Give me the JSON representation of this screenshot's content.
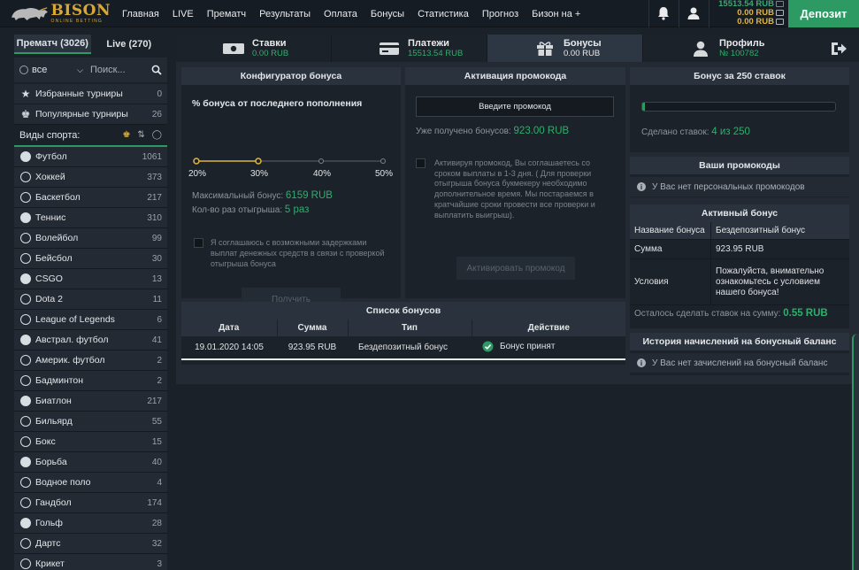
{
  "header": {
    "logo_main": "BISON",
    "logo_sub": "ONLINE BETTING",
    "nav": [
      "Главная",
      "LIVE",
      "Прематч",
      "Результаты",
      "Оплата",
      "Бонусы",
      "Статистика",
      "Прогноз",
      "Бизон на +"
    ],
    "balance_main": "15513.54 RUB",
    "balance_bonus": "0.00 RUB",
    "balance_extra": "0.00 RUB",
    "deposit_label": "Депозит",
    "icons": [
      "bell-icon",
      "user-icon"
    ]
  },
  "sidebar": {
    "tabs": [
      {
        "label": "Прематч (3026)"
      },
      {
        "label": "Live (270)"
      }
    ],
    "filter_label": "все",
    "search_placeholder": "Поиск...",
    "top_items": [
      {
        "label": "Избранные турниры",
        "count": "0"
      },
      {
        "label": "Популярные турниры",
        "count": "26"
      }
    ],
    "sports_label": "Виды спорта:",
    "sports": [
      {
        "label": "Футбол",
        "count": "1061"
      },
      {
        "label": "Хоккей",
        "count": "373"
      },
      {
        "label": "Баскетбол",
        "count": "217"
      },
      {
        "label": "Теннис",
        "count": "310"
      },
      {
        "label": "Волейбол",
        "count": "99"
      },
      {
        "label": "Бейсбол",
        "count": "30"
      },
      {
        "label": "CSGO",
        "count": "13"
      },
      {
        "label": "Dota 2",
        "count": "11"
      },
      {
        "label": "League of Legends",
        "count": "6"
      },
      {
        "label": "Австрал. футбол",
        "count": "41"
      },
      {
        "label": "Америк. футбол",
        "count": "2"
      },
      {
        "label": "Бадминтон",
        "count": "2"
      },
      {
        "label": "Биатлон",
        "count": "217"
      },
      {
        "label": "Бильярд",
        "count": "55"
      },
      {
        "label": "Бокс",
        "count": "15"
      },
      {
        "label": "Борьба",
        "count": "40"
      },
      {
        "label": "Водное поло",
        "count": "4"
      },
      {
        "label": "Гандбол",
        "count": "174"
      },
      {
        "label": "Гольф",
        "count": "28"
      },
      {
        "label": "Дартс",
        "count": "32"
      },
      {
        "label": "Крикет",
        "count": "3"
      }
    ]
  },
  "account_tabs": [
    {
      "name": "Ставки",
      "sub": "0.00 RUB"
    },
    {
      "name": "Платежи",
      "sub": "15513.54 RUB"
    },
    {
      "name": "Бонусы",
      "sub": "0.00 RUB"
    },
    {
      "name": "Профиль",
      "sub": "№ 100782"
    }
  ],
  "configurator": {
    "title": "Конфигуратор бонуса",
    "subtitle": "% бонуса от последнего пополнения",
    "steps": [
      "20%",
      "30%",
      "40%",
      "50%"
    ],
    "selected_step_index": 1,
    "max_bonus_label": "Максимальный бонус:",
    "max_bonus_value": "6159 RUB",
    "wager_label": "Кол-во раз отыгрыша:",
    "wager_value": "5 раз",
    "agree_text": "Я соглашаюсь с возможными задержками выплат денежных средств в связи с проверкой отыгрыша бонуса",
    "button": "Получить"
  },
  "promo": {
    "title": "Активация промокода",
    "input_placeholder": "Введите промокод",
    "received_label": "Уже получено бонусов:",
    "received_value": "923.00 RUB",
    "agree_text": "Активируя промокод, Вы соглашаетесь со сроком выплаты в 1-3 дня. ( Для проверки отыгрыша бонуса букмекеру необходимо дополнительное время. Мы постараемся в кратчайшие сроки провести все проверки и выплатить выигрыш).",
    "button": "Активировать промокод"
  },
  "bonus_250": {
    "title": "Бонус за 250 ставок",
    "progress_fraction": 0.016,
    "made_label": "Сделано ставок:",
    "made_value": "4 из 250"
  },
  "your_promos": {
    "title": "Ваши промокоды",
    "empty_text": "У Вас нет персональных промокодов"
  },
  "active_bonus": {
    "title": "Активный бонус",
    "name_label": "Название бонуса",
    "name_value": "Бездепозитный бонус",
    "sum_label": "Сумма",
    "sum_value": "923.95 RUB",
    "cond_label": "Условия",
    "cond_value": "Пожалуйста, внимательно ознакомьтесь с условием нашего бонуса!",
    "remain_label": "Осталось сделать ставок на сумму:",
    "remain_value": "0.55 RUB"
  },
  "history": {
    "title": "История начислений на бонусный баланс",
    "empty_text": "У Вас нет зачислений на бонусный баланс"
  },
  "bonus_list": {
    "title": "Список бонусов",
    "columns": [
      "Дата",
      "Сумма",
      "Тип",
      "Действие"
    ],
    "rows": [
      {
        "date": "19.01.2020 14:05",
        "sum": "923.95 RUB",
        "type": "Бездепозитный бонус",
        "action": "Бонус принят"
      }
    ]
  },
  "colors": {
    "accent": "#2d9a63",
    "gold": "#e0b540",
    "bg": "#1b2129"
  }
}
